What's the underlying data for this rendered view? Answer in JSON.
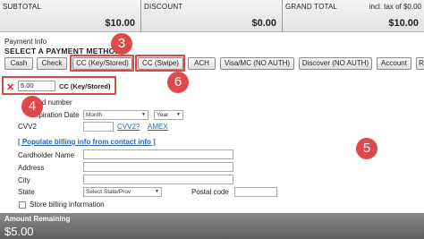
{
  "totals": {
    "subtotal_label": "SUBTOTAL",
    "subtotal_value": "$10.00",
    "discount_label": "DISCOUNT",
    "discount_value": "$0.00",
    "grand_total_label": "GRAND TOTAL",
    "tax_note": "incl. tax of $0.00",
    "grand_total_value": "$10.00"
  },
  "payment": {
    "title": "Payment Info",
    "select_label": "SELECT A PAYMENT METHOD",
    "methods": [
      "Cash",
      "Check",
      "CC (Key/Stored)",
      "CC (Swipe)",
      "ACH",
      "Visa/MC (NO AUTH)",
      "Discover (NO AUTH)",
      "Account",
      "Rela"
    ]
  },
  "stored": {
    "amount": "5.00",
    "method": "CC (Key/Stored)"
  },
  "form": {
    "card_number_label": "Card number",
    "expiration_label": "Expiration Date",
    "month_placeholder": "Month",
    "year_placeholder": "Year",
    "cvv2_label": "CVV2",
    "cvv2_link": "CVV2?",
    "amex_link": "AMEX",
    "populate_link": "[ Populate billing info from contact info ]",
    "cardholder_label": "Cardholder Name",
    "address_label": "Address",
    "city_label": "City",
    "state_label": "State",
    "state_placeholder": "Select State/Prov",
    "postal_label": "Postal code",
    "store_billing_label": "Store billing information"
  },
  "amount_remaining": {
    "label": "Amount Remaining",
    "value": "$5.00"
  },
  "annotations": {
    "callout_3": "3",
    "callout_4": "4",
    "callout_5": "5",
    "callout_6": "6",
    "highlight_color": "#d84b4b",
    "circle_color": "#e0494b"
  }
}
